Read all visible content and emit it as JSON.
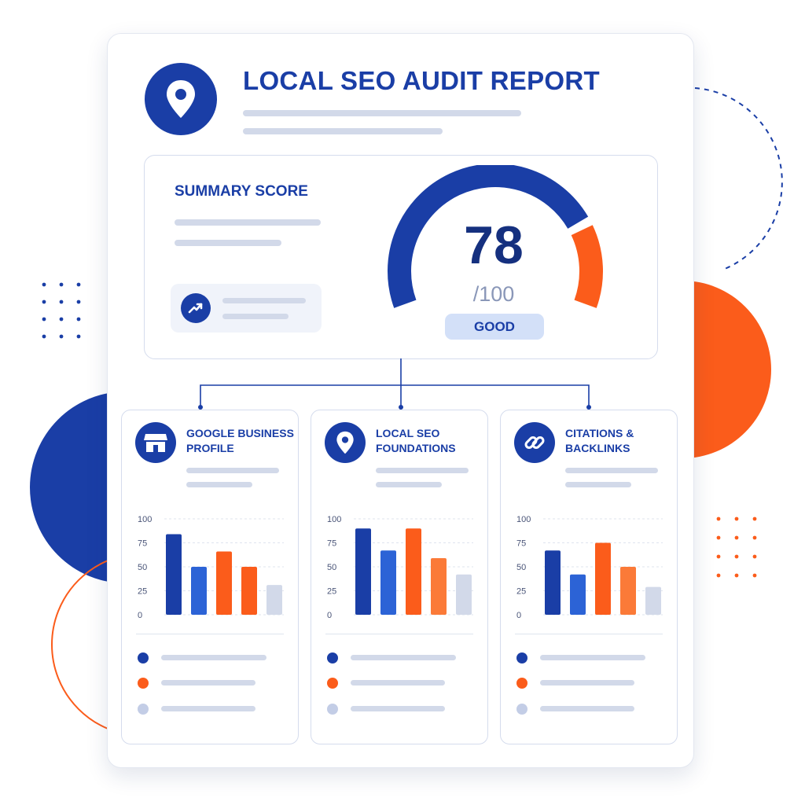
{
  "header": {
    "title": "LOCAL SEO AUDIT REPORT",
    "logo_icon": "location-pin-icon"
  },
  "summary": {
    "title": "SUMMARY SCORE",
    "trend_icon": "trending-up-icon",
    "score": "78",
    "score_max": "/100",
    "rating": "GOOD",
    "score_fraction": 0.78
  },
  "colors": {
    "primary_blue": "#1a3ea6",
    "medium_blue": "#2c63d6",
    "orange": "#fb5c1b",
    "light_orange": "#fb7a38",
    "gray": "#d2d9e9"
  },
  "chart_data": [
    {
      "type": "bar",
      "title": "GOOGLE BUSINESS PROFILE",
      "icon": "storefront-icon",
      "yticks": [
        "100",
        "75",
        "50",
        "25",
        "0"
      ],
      "ylim": [
        0,
        100
      ],
      "values": [
        84,
        50,
        66,
        50,
        31
      ],
      "bar_colors": [
        "#1a3ea6",
        "#2c63d6",
        "#fb5c1b",
        "#fb5c1b",
        "#d2d9e9"
      ]
    },
    {
      "type": "bar",
      "title": "LOCAL SEO FOUNDATIONS",
      "icon": "location-pin-icon",
      "yticks": [
        "100",
        "75",
        "50",
        "25",
        "0"
      ],
      "ylim": [
        0,
        100
      ],
      "values": [
        90,
        67,
        90,
        59,
        42
      ],
      "bar_colors": [
        "#1a3ea6",
        "#2c63d6",
        "#fb5c1b",
        "#fb7a38",
        "#d2d9e9"
      ]
    },
    {
      "type": "bar",
      "title": "CITATIONS & BACKLINKS",
      "icon": "link-icon",
      "yticks": [
        "100",
        "75",
        "50",
        "25",
        "0"
      ],
      "ylim": [
        0,
        100
      ],
      "values": [
        67,
        42,
        75,
        50,
        29
      ],
      "bar_colors": [
        "#1a3ea6",
        "#2c63d6",
        "#fb5c1b",
        "#fb7a38",
        "#d2d9e9"
      ]
    }
  ]
}
